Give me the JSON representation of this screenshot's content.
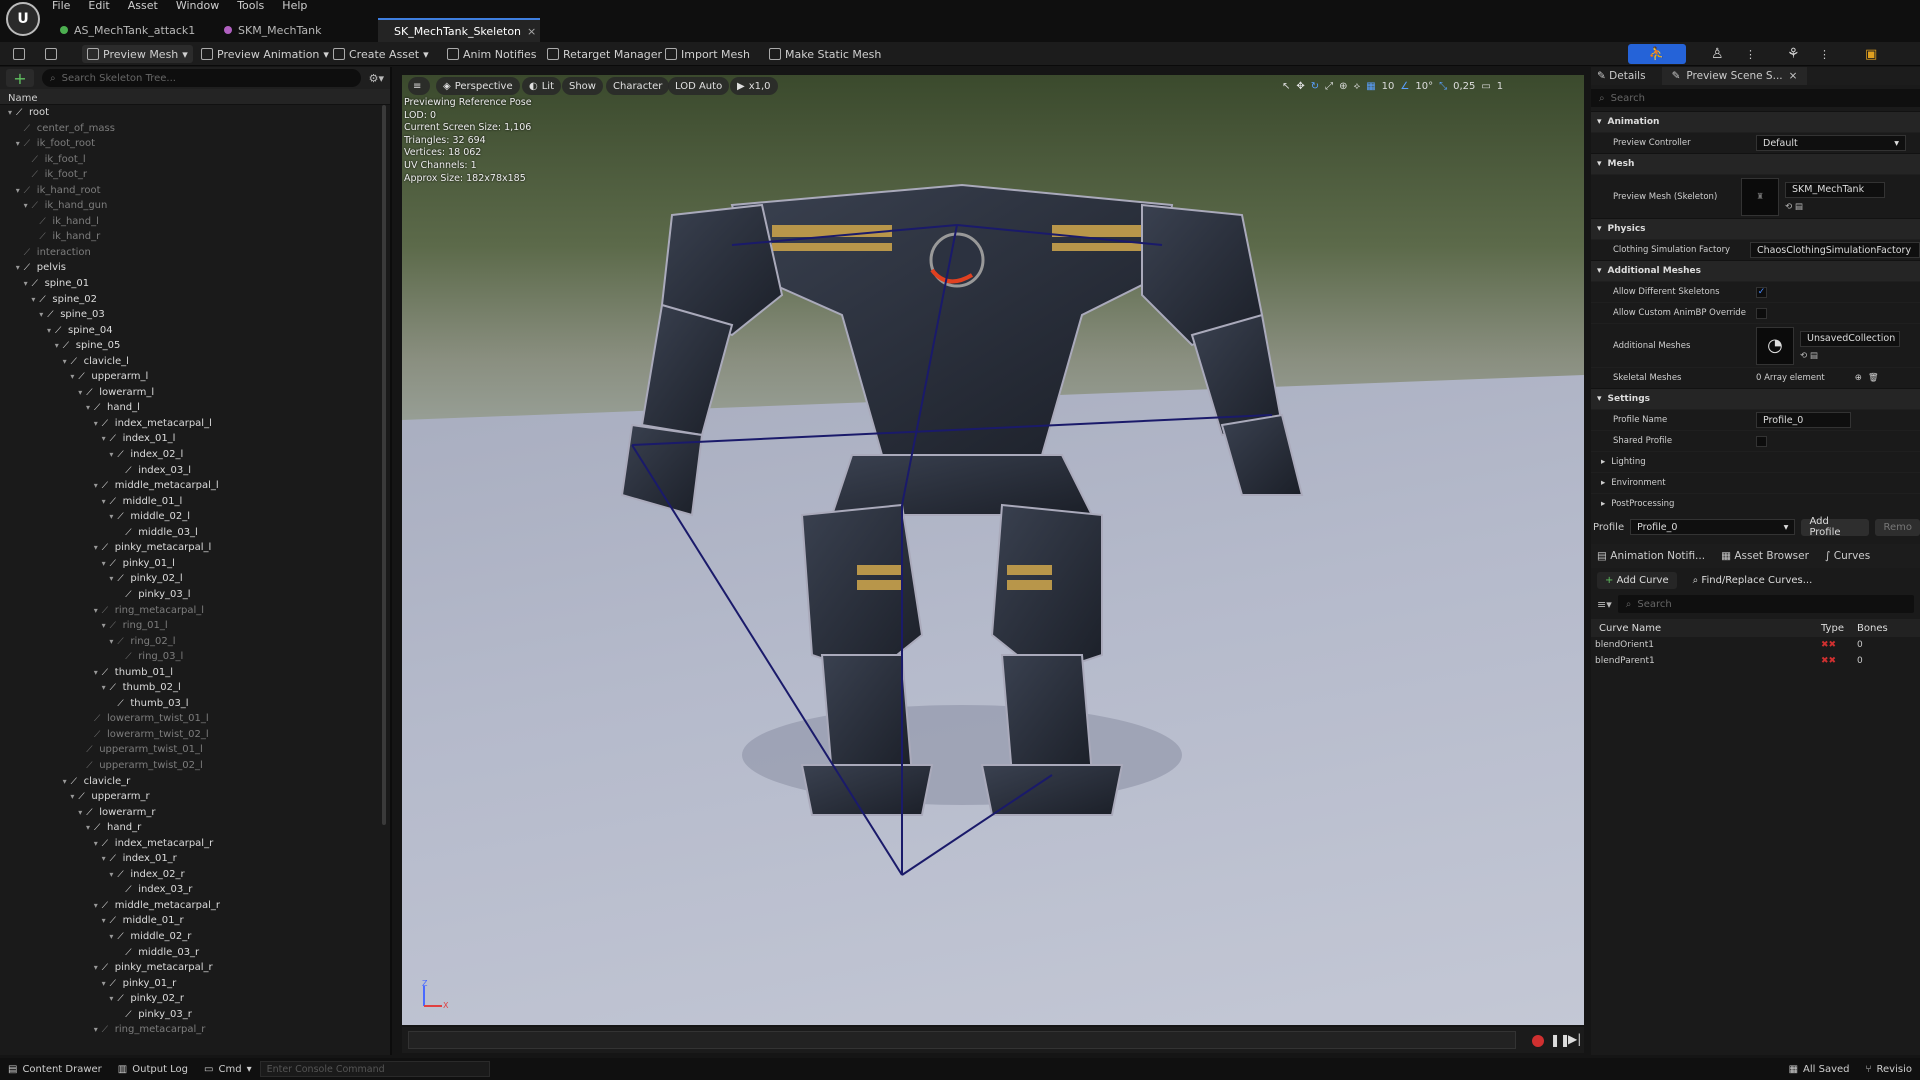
{
  "menu": [
    "File",
    "Edit",
    "Asset",
    "Window",
    "Tools",
    "Help"
  ],
  "tabs": [
    {
      "label": "AS_MechTank_attack1",
      "active": false,
      "color": "#4caf50"
    },
    {
      "label": "SKM_MechTank",
      "active": false,
      "color": "#b060c0"
    },
    {
      "label": "SK_MechTank_Skeleton",
      "active": true,
      "color": "#d0d0d0",
      "close": "×"
    }
  ],
  "toolbar": {
    "preview_mesh": "Preview Mesh",
    "preview_animation": "Preview Animation",
    "create_asset": "Create Asset",
    "anim_notifies": "Anim Notifies",
    "retarget_manager": "Retarget Manager",
    "import_mesh": "Import Mesh",
    "make_static_mesh": "Make Static Mesh"
  },
  "skeleton_tree": {
    "search_placeholder": "Search Skeleton Tree...",
    "column": "Name",
    "rows": [
      {
        "name": "root",
        "depth": 0,
        "exp": true,
        "dim": false
      },
      {
        "name": "center_of_mass",
        "depth": 1,
        "exp": false,
        "dim": true
      },
      {
        "name": "ik_foot_root",
        "depth": 1,
        "exp": true,
        "dim": true
      },
      {
        "name": "ik_foot_l",
        "depth": 2,
        "exp": false,
        "dim": true
      },
      {
        "name": "ik_foot_r",
        "depth": 2,
        "exp": false,
        "dim": true
      },
      {
        "name": "ik_hand_root",
        "depth": 1,
        "exp": true,
        "dim": true
      },
      {
        "name": "ik_hand_gun",
        "depth": 2,
        "exp": true,
        "dim": true
      },
      {
        "name": "ik_hand_l",
        "depth": 3,
        "exp": false,
        "dim": true
      },
      {
        "name": "ik_hand_r",
        "depth": 3,
        "exp": false,
        "dim": true
      },
      {
        "name": "interaction",
        "depth": 1,
        "exp": false,
        "dim": true
      },
      {
        "name": "pelvis",
        "depth": 1,
        "exp": true,
        "dim": false
      },
      {
        "name": "spine_01",
        "depth": 2,
        "exp": true,
        "dim": false
      },
      {
        "name": "spine_02",
        "depth": 3,
        "exp": true,
        "dim": false
      },
      {
        "name": "spine_03",
        "depth": 4,
        "exp": true,
        "dim": false
      },
      {
        "name": "spine_04",
        "depth": 5,
        "exp": true,
        "dim": false
      },
      {
        "name": "spine_05",
        "depth": 6,
        "exp": true,
        "dim": false
      },
      {
        "name": "clavicle_l",
        "depth": 7,
        "exp": true,
        "dim": false
      },
      {
        "name": "upperarm_l",
        "depth": 8,
        "exp": true,
        "dim": false
      },
      {
        "name": "lowerarm_l",
        "depth": 9,
        "exp": true,
        "dim": false
      },
      {
        "name": "hand_l",
        "depth": 10,
        "exp": true,
        "dim": false
      },
      {
        "name": "index_metacarpal_l",
        "depth": 11,
        "exp": true,
        "dim": false
      },
      {
        "name": "index_01_l",
        "depth": 12,
        "exp": true,
        "dim": false
      },
      {
        "name": "index_02_l",
        "depth": 13,
        "exp": true,
        "dim": false
      },
      {
        "name": "index_03_l",
        "depth": 14,
        "exp": false,
        "dim": false
      },
      {
        "name": "middle_metacarpal_l",
        "depth": 11,
        "exp": true,
        "dim": false
      },
      {
        "name": "middle_01_l",
        "depth": 12,
        "exp": true,
        "dim": false
      },
      {
        "name": "middle_02_l",
        "depth": 13,
        "exp": true,
        "dim": false
      },
      {
        "name": "middle_03_l",
        "depth": 14,
        "exp": false,
        "dim": false
      },
      {
        "name": "pinky_metacarpal_l",
        "depth": 11,
        "exp": true,
        "dim": false
      },
      {
        "name": "pinky_01_l",
        "depth": 12,
        "exp": true,
        "dim": false
      },
      {
        "name": "pinky_02_l",
        "depth": 13,
        "exp": true,
        "dim": false
      },
      {
        "name": "pinky_03_l",
        "depth": 14,
        "exp": false,
        "dim": false
      },
      {
        "name": "ring_metacarpal_l",
        "depth": 11,
        "exp": true,
        "dim": true
      },
      {
        "name": "ring_01_l",
        "depth": 12,
        "exp": true,
        "dim": true
      },
      {
        "name": "ring_02_l",
        "depth": 13,
        "exp": true,
        "dim": true
      },
      {
        "name": "ring_03_l",
        "depth": 14,
        "exp": false,
        "dim": true
      },
      {
        "name": "thumb_01_l",
        "depth": 11,
        "exp": true,
        "dim": false
      },
      {
        "name": "thumb_02_l",
        "depth": 12,
        "exp": true,
        "dim": false
      },
      {
        "name": "thumb_03_l",
        "depth": 13,
        "exp": false,
        "dim": false
      },
      {
        "name": "lowerarm_twist_01_l",
        "depth": 10,
        "exp": false,
        "dim": true
      },
      {
        "name": "lowerarm_twist_02_l",
        "depth": 10,
        "exp": false,
        "dim": true
      },
      {
        "name": "upperarm_twist_01_l",
        "depth": 9,
        "exp": false,
        "dim": true
      },
      {
        "name": "upperarm_twist_02_l",
        "depth": 9,
        "exp": false,
        "dim": true
      },
      {
        "name": "clavicle_r",
        "depth": 7,
        "exp": true,
        "dim": false
      },
      {
        "name": "upperarm_r",
        "depth": 8,
        "exp": true,
        "dim": false
      },
      {
        "name": "lowerarm_r",
        "depth": 9,
        "exp": true,
        "dim": false
      },
      {
        "name": "hand_r",
        "depth": 10,
        "exp": true,
        "dim": false
      },
      {
        "name": "index_metacarpal_r",
        "depth": 11,
        "exp": true,
        "dim": false
      },
      {
        "name": "index_01_r",
        "depth": 12,
        "exp": true,
        "dim": false
      },
      {
        "name": "index_02_r",
        "depth": 13,
        "exp": true,
        "dim": false
      },
      {
        "name": "index_03_r",
        "depth": 14,
        "exp": false,
        "dim": false
      },
      {
        "name": "middle_metacarpal_r",
        "depth": 11,
        "exp": true,
        "dim": false
      },
      {
        "name": "middle_01_r",
        "depth": 12,
        "exp": true,
        "dim": false
      },
      {
        "name": "middle_02_r",
        "depth": 13,
        "exp": true,
        "dim": false
      },
      {
        "name": "middle_03_r",
        "depth": 14,
        "exp": false,
        "dim": false
      },
      {
        "name": "pinky_metacarpal_r",
        "depth": 11,
        "exp": true,
        "dim": false
      },
      {
        "name": "pinky_01_r",
        "depth": 12,
        "exp": true,
        "dim": false
      },
      {
        "name": "pinky_02_r",
        "depth": 13,
        "exp": true,
        "dim": false
      },
      {
        "name": "pinky_03_r",
        "depth": 14,
        "exp": false,
        "dim": false
      },
      {
        "name": "ring_metacarpal_r",
        "depth": 11,
        "exp": true,
        "dim": true
      }
    ]
  },
  "viewport": {
    "perspective": "Perspective",
    "lit": "Lit",
    "show": "Show",
    "character": "Character",
    "lod": "LOD Auto",
    "speed": "x1,0",
    "info": [
      "Previewing Reference Pose",
      "LOD: 0",
      "Current Screen Size: 1,106",
      "Triangles: 32 694",
      "Vertices: 18 062",
      "UV Channels: 1",
      "Approx Size: 182x78x185"
    ],
    "grid_snap": "10",
    "rot_snap": "10°",
    "scale_snap": "0,25",
    "cam_speed": "1"
  },
  "details": {
    "tab_details": "Details",
    "tab_preview": "Preview Scene S...",
    "search_placeholder": "Search",
    "cat_animation": "Animation",
    "preview_controller_label": "Preview Controller",
    "preview_controller_value": "Default",
    "cat_mesh": "Mesh",
    "preview_mesh_label": "Preview Mesh (Skeleton)",
    "preview_mesh_value": "SKM_MechTank",
    "cat_physics": "Physics",
    "clothing_label": "Clothing Simulation Factory",
    "clothing_value": "ChaosClothingSimulationFactory",
    "cat_additional": "Additional Meshes",
    "allow_diff_label": "Allow Different Skeletons",
    "allow_custom_label": "Allow Custom AnimBP Override",
    "additional_meshes_label": "Additional Meshes",
    "additional_meshes_value": "UnsavedCollection",
    "skeletal_meshes_label": "Skeletal Meshes",
    "skeletal_meshes_value": "0 Array element",
    "cat_settings": "Settings",
    "profile_name_label": "Profile Name",
    "profile_name_value": "Profile_0",
    "shared_profile_label": "Shared Profile",
    "lighting": "Lighting",
    "environment": "Environment",
    "postprocessing": "PostProcessing",
    "profile_label": "Profile",
    "profile_value": "Profile_0",
    "add_profile": "Add Profile",
    "remove": "Remo"
  },
  "curves": {
    "tab_anim": "Animation Notifi...",
    "tab_asset": "Asset Browser",
    "tab_curves": "Curves",
    "add_curve": "Add Curve",
    "find_replace": "Find/Replace Curves...",
    "search_placeholder": "Search",
    "col_name": "Curve Name",
    "col_type": "Type",
    "col_bones": "Bones",
    "rows": [
      {
        "name": "blendOrient1",
        "bones": "0"
      },
      {
        "name": "blendParent1",
        "bones": "0"
      }
    ]
  },
  "statusbar": {
    "content_drawer": "Content Drawer",
    "output_log": "Output Log",
    "cmd": "Cmd",
    "console_placeholder": "Enter Console Command",
    "all_saved": "All Saved",
    "revision": "Revisio"
  },
  "colors": {
    "accent": "#2563d8",
    "record": "#d03030"
  }
}
